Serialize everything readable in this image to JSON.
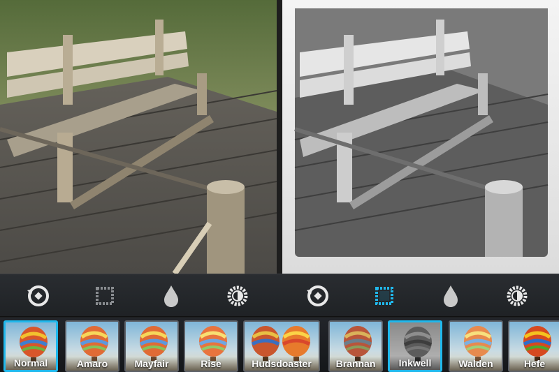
{
  "colors": {
    "accent": "#20b8ec",
    "toolbar_bg": "#24272b",
    "icon_gray": "#c9c9c9"
  },
  "toolbar": {
    "left": [
      {
        "name": "rotate-icon"
      },
      {
        "name": "border-frame-icon"
      },
      {
        "name": "tilt-shift-drop-icon"
      },
      {
        "name": "lux-brightness-icon"
      }
    ],
    "right": [
      {
        "name": "rotate-icon"
      },
      {
        "name": "border-frame-icon",
        "active": true
      },
      {
        "name": "tilt-shift-drop-icon"
      },
      {
        "name": "lux-brightness-icon"
      }
    ]
  },
  "filters": [
    {
      "label": "Normal",
      "selected": true
    },
    {
      "label": "Amaro"
    },
    {
      "label": "Mayfair"
    },
    {
      "label": "Rise"
    },
    {
      "label": "Hudsdoaster"
    },
    {
      "label": "Brannan"
    },
    {
      "label": "Inkwell",
      "selected": true
    },
    {
      "label": "Walden"
    },
    {
      "label": "Hefe"
    }
  ]
}
